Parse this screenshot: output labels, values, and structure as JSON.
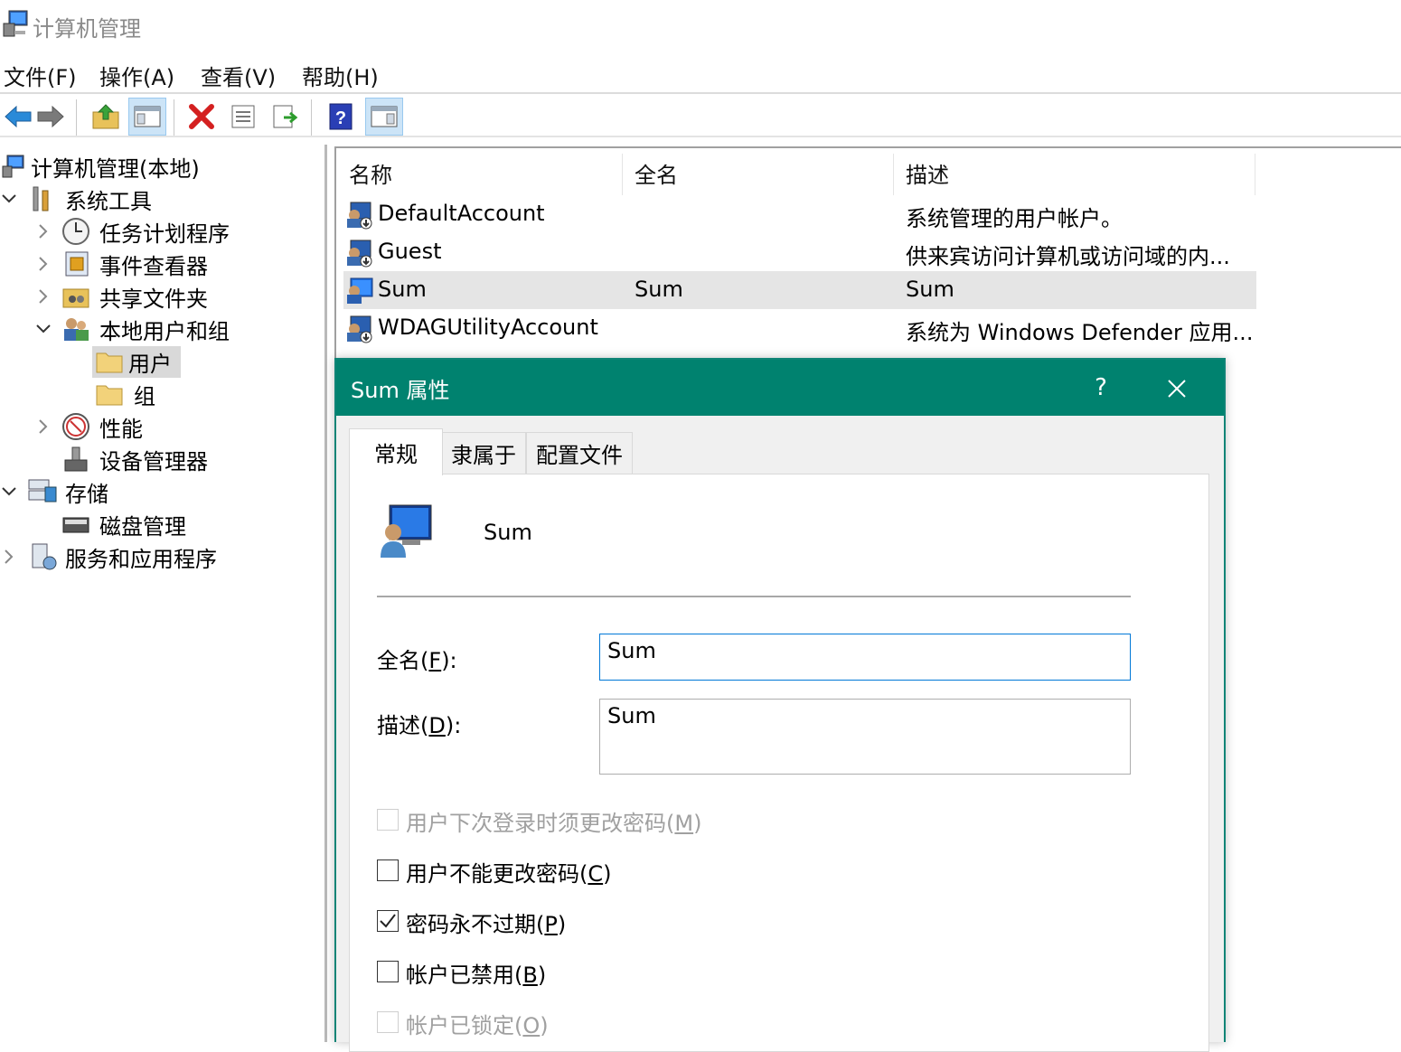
{
  "window": {
    "title": "计算机管理"
  },
  "menu": [
    "文件(F)",
    "操作(A)",
    "查看(V)",
    "帮助(H)"
  ],
  "tree": {
    "root": "计算机管理(本地)",
    "system_tools": "系统工具",
    "task_scheduler": "任务计划程序",
    "event_viewer": "事件查看器",
    "shared_folders": "共享文件夹",
    "local_users_groups": "本地用户和组",
    "users": "用户",
    "groups": "组",
    "performance": "性能",
    "device_manager": "设备管理器",
    "storage": "存储",
    "disk_management": "磁盘管理",
    "services_apps": "服务和应用程序"
  },
  "list": {
    "columns": [
      "名称",
      "全名",
      "描述"
    ],
    "rows": [
      {
        "name": "DefaultAccount",
        "fullname": "",
        "desc": "系统管理的用户帐户。"
      },
      {
        "name": "Guest",
        "fullname": "",
        "desc": "供来宾访问计算机或访问域的内..."
      },
      {
        "name": "Sum",
        "fullname": "Sum",
        "desc": "Sum"
      },
      {
        "name": "WDAGUtilityAccount",
        "fullname": "",
        "desc": "系统为 Windows Defender 应用..."
      }
    ]
  },
  "dialog": {
    "title": "Sum 属性",
    "help": "?",
    "tabs": [
      "常规",
      "隶属于",
      "配置文件"
    ],
    "username": "Sum",
    "fullname_label_pre": "全名(",
    "fullname_label_key": "F",
    "fullname_label_post": "):",
    "fullname_value": "Sum",
    "desc_label_pre": "描述(",
    "desc_label_key": "D",
    "desc_label_post": "):",
    "desc_value": "Sum",
    "checkboxes": [
      {
        "pre": "用户下次登录时须更改密码(",
        "key": "M",
        "post": ")",
        "checked": false,
        "disabled": true
      },
      {
        "pre": "用户不能更改密码(",
        "key": "C",
        "post": ")",
        "checked": false,
        "disabled": false
      },
      {
        "pre": "密码永不过期(",
        "key": "P",
        "post": ")",
        "checked": true,
        "disabled": false
      },
      {
        "pre": "帐户已禁用(",
        "key": "B",
        "post": ")",
        "checked": false,
        "disabled": false
      },
      {
        "pre": "帐户已锁定(",
        "key": "O",
        "post": ")",
        "checked": false,
        "disabled": true
      }
    ]
  },
  "colors": {
    "dialog_title_bg": "#00826f",
    "selection_bg": "#e5e5e5",
    "focus_border": "#0078d7"
  }
}
